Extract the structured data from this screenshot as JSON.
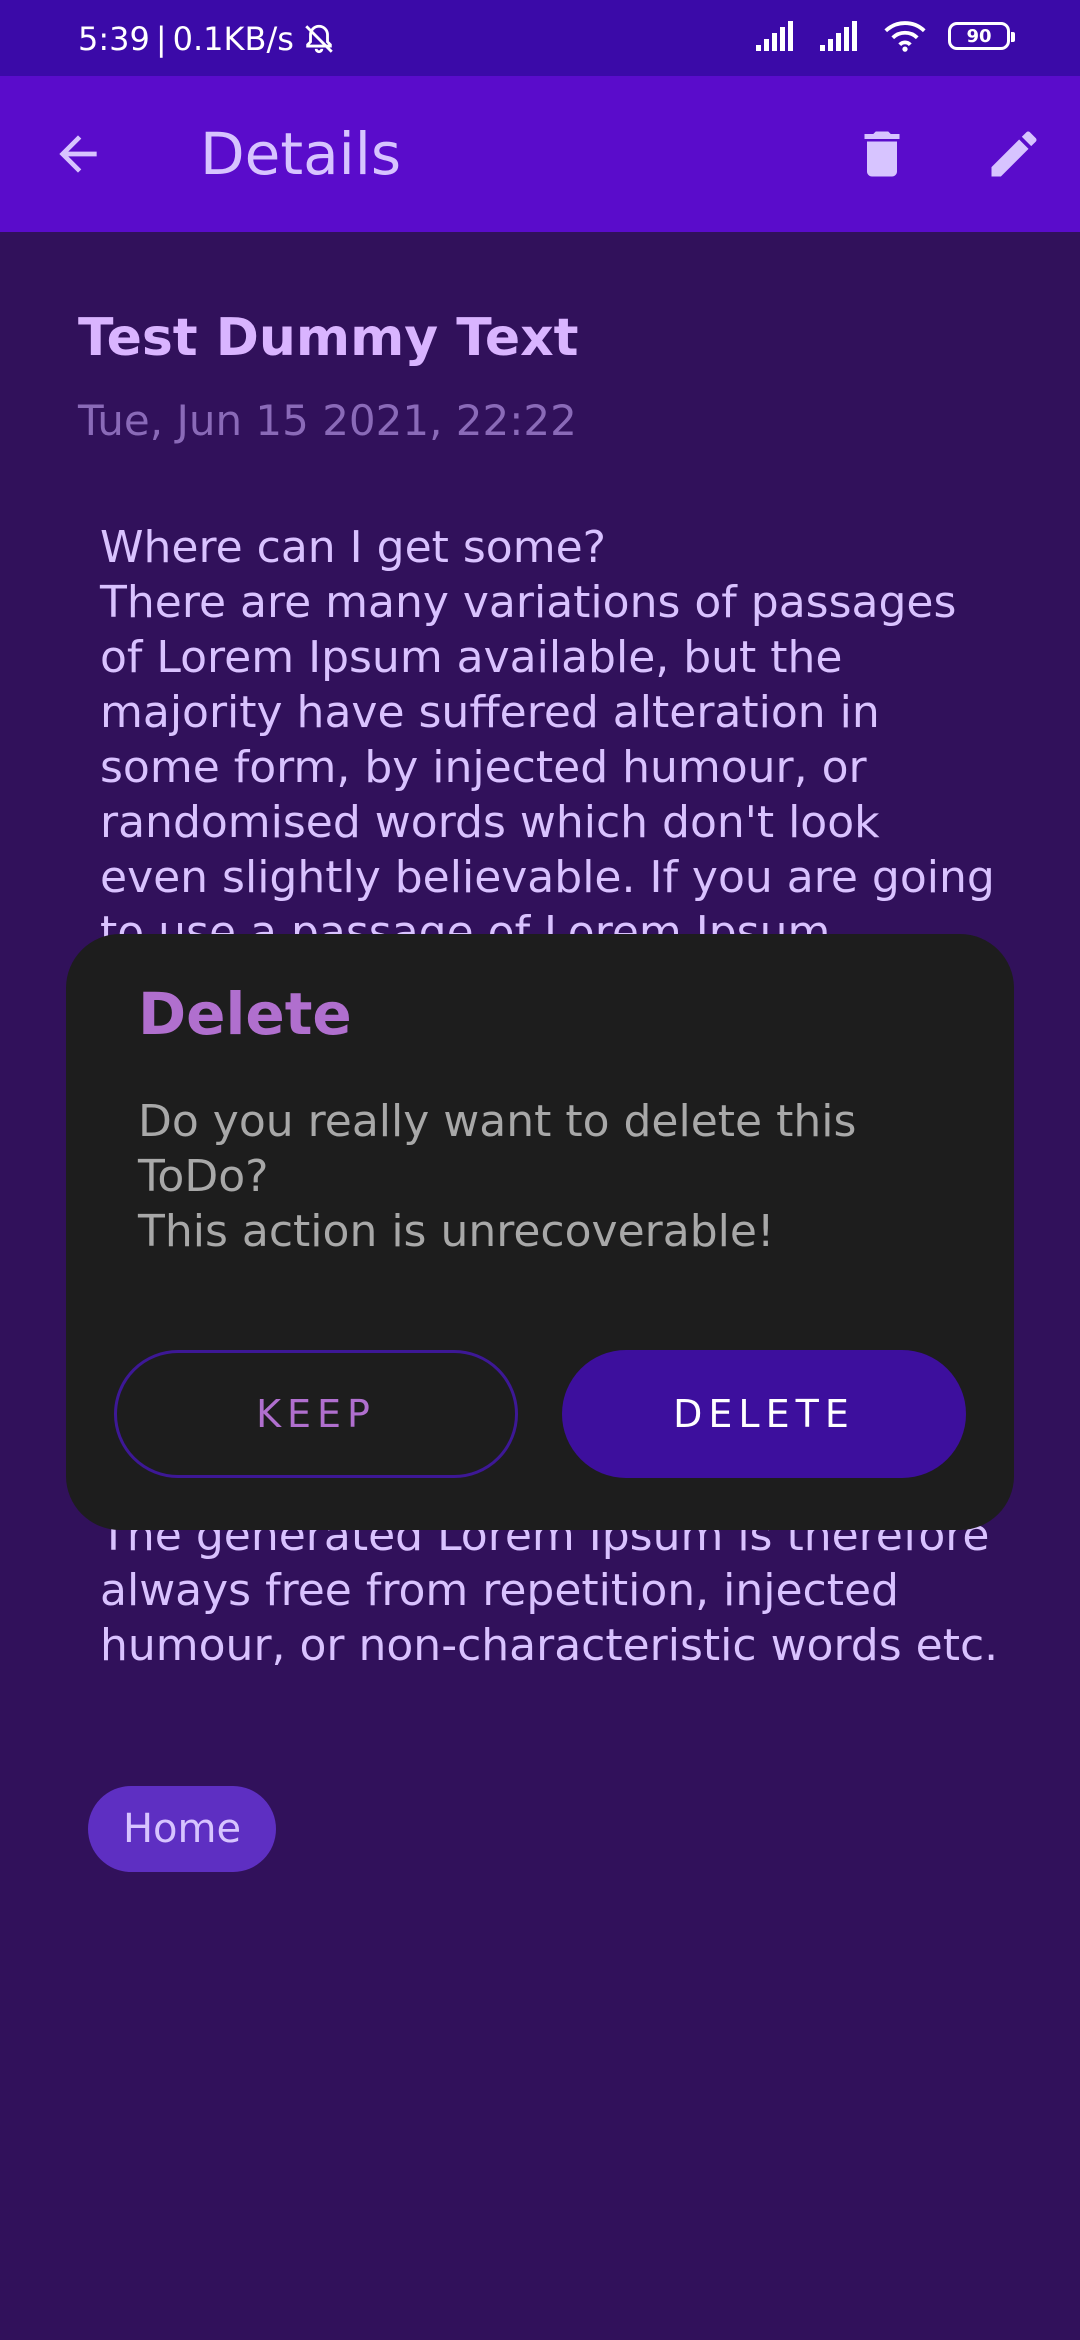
{
  "status_bar": {
    "time": "5:39",
    "separator": "|",
    "net_speed": "0.1KB/s",
    "battery": "90"
  },
  "app_bar": {
    "title": "Details",
    "back_icon": "arrow-back-icon",
    "delete_icon": "trash-icon",
    "edit_icon": "pencil-icon"
  },
  "note": {
    "title": "Test Dummy Text",
    "date": "Tue, Jun 15 2021, 22:22",
    "body_top": "Where can I get some?\nThere are many variations of passages of Lorem Ipsum available, but the majority have suffered alteration in some form, by injected humour, or randomised words which don't look even slightly believable. If you are going to use a passage of Lorem Ipsum",
    "body_bottom": "The generated Lorem Ipsum is therefore always free from repetition, injected humour, or non-characteristic words etc.",
    "category_chip": "Home"
  },
  "dialog": {
    "title": "Delete",
    "message": "Do you really want to delete this ToDo?\nThis action is unrecoverable!",
    "keep_label": "KEEP",
    "delete_label": "DELETE"
  },
  "colors": {
    "status_bar": "#3b0aa8",
    "app_bar": "#5a0ccb",
    "background": "#31115b",
    "dialog": "#1d1d1d",
    "accent": "#b06fce",
    "delete_button": "#3d0f9d"
  }
}
